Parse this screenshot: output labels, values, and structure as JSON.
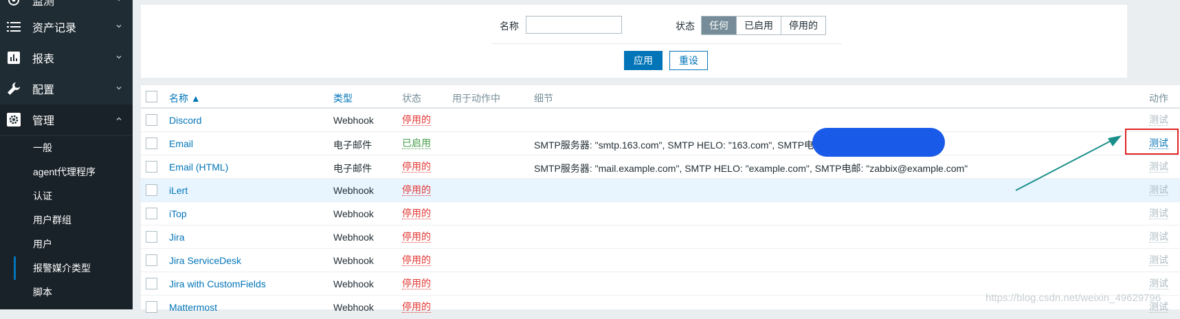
{
  "sidebar": {
    "nav": [
      {
        "label": "监测",
        "icon": "eye-icon"
      },
      {
        "label": "资产记录",
        "icon": "list-icon"
      },
      {
        "label": "报表",
        "icon": "bar-chart-icon"
      },
      {
        "label": "配置",
        "icon": "wrench-icon"
      },
      {
        "label": "管理",
        "icon": "gear-icon"
      }
    ],
    "submenu": [
      "一般",
      "agent代理程序",
      "认证",
      "用户群组",
      "用户",
      "报警媒介类型",
      "脚本"
    ]
  },
  "filter": {
    "name_label": "名称",
    "name_value": "",
    "status_label": "状态",
    "status_options": [
      "任何",
      "已启用",
      "停用的"
    ],
    "apply": "应用",
    "reset": "重设"
  },
  "table": {
    "columns": [
      "名称 ▲",
      "类型",
      "状态",
      "用于动作中",
      "细节",
      "动作"
    ],
    "rows": [
      {
        "name": "Discord",
        "type": "Webhook",
        "status": "停用的",
        "detail": "",
        "action": "测试"
      },
      {
        "name": "Email",
        "type": "电子邮件",
        "status": "已启用",
        "detail": "SMTP服务器: \"smtp.163.com\", SMTP HELO: \"163.com\", SMTP电邮",
        "action": "测试"
      },
      {
        "name": "Email (HTML)",
        "type": "电子邮件",
        "status": "停用的",
        "detail": "SMTP服务器: \"mail.example.com\", SMTP HELO: \"example.com\", SMTP电邮: \"zabbix@example.com\"",
        "action": "测试"
      },
      {
        "name": "iLert",
        "type": "Webhook",
        "status": "停用的",
        "detail": "",
        "action": "测试"
      },
      {
        "name": "iTop",
        "type": "Webhook",
        "status": "停用的",
        "detail": "",
        "action": "测试"
      },
      {
        "name": "Jira",
        "type": "Webhook",
        "status": "停用的",
        "detail": "",
        "action": "测试"
      },
      {
        "name": "Jira ServiceDesk",
        "type": "Webhook",
        "status": "停用的",
        "detail": "",
        "action": "测试"
      },
      {
        "name": "Jira with CustomFields",
        "type": "Webhook",
        "status": "停用的",
        "detail": "",
        "action": "测试"
      },
      {
        "name": "Mattermost",
        "type": "Webhook",
        "status": "停用的",
        "detail": "",
        "action": "测试"
      }
    ]
  },
  "watermark": "https://blog.csdn.net/weixin_49629796",
  "colors": {
    "sidebar": "#1f2c33",
    "link": "#0275b8",
    "disabled": "#e33734",
    "enabled": "#429e47",
    "annotation_arrow": "#1a8f8a",
    "annotation_box": "#e02222"
  }
}
